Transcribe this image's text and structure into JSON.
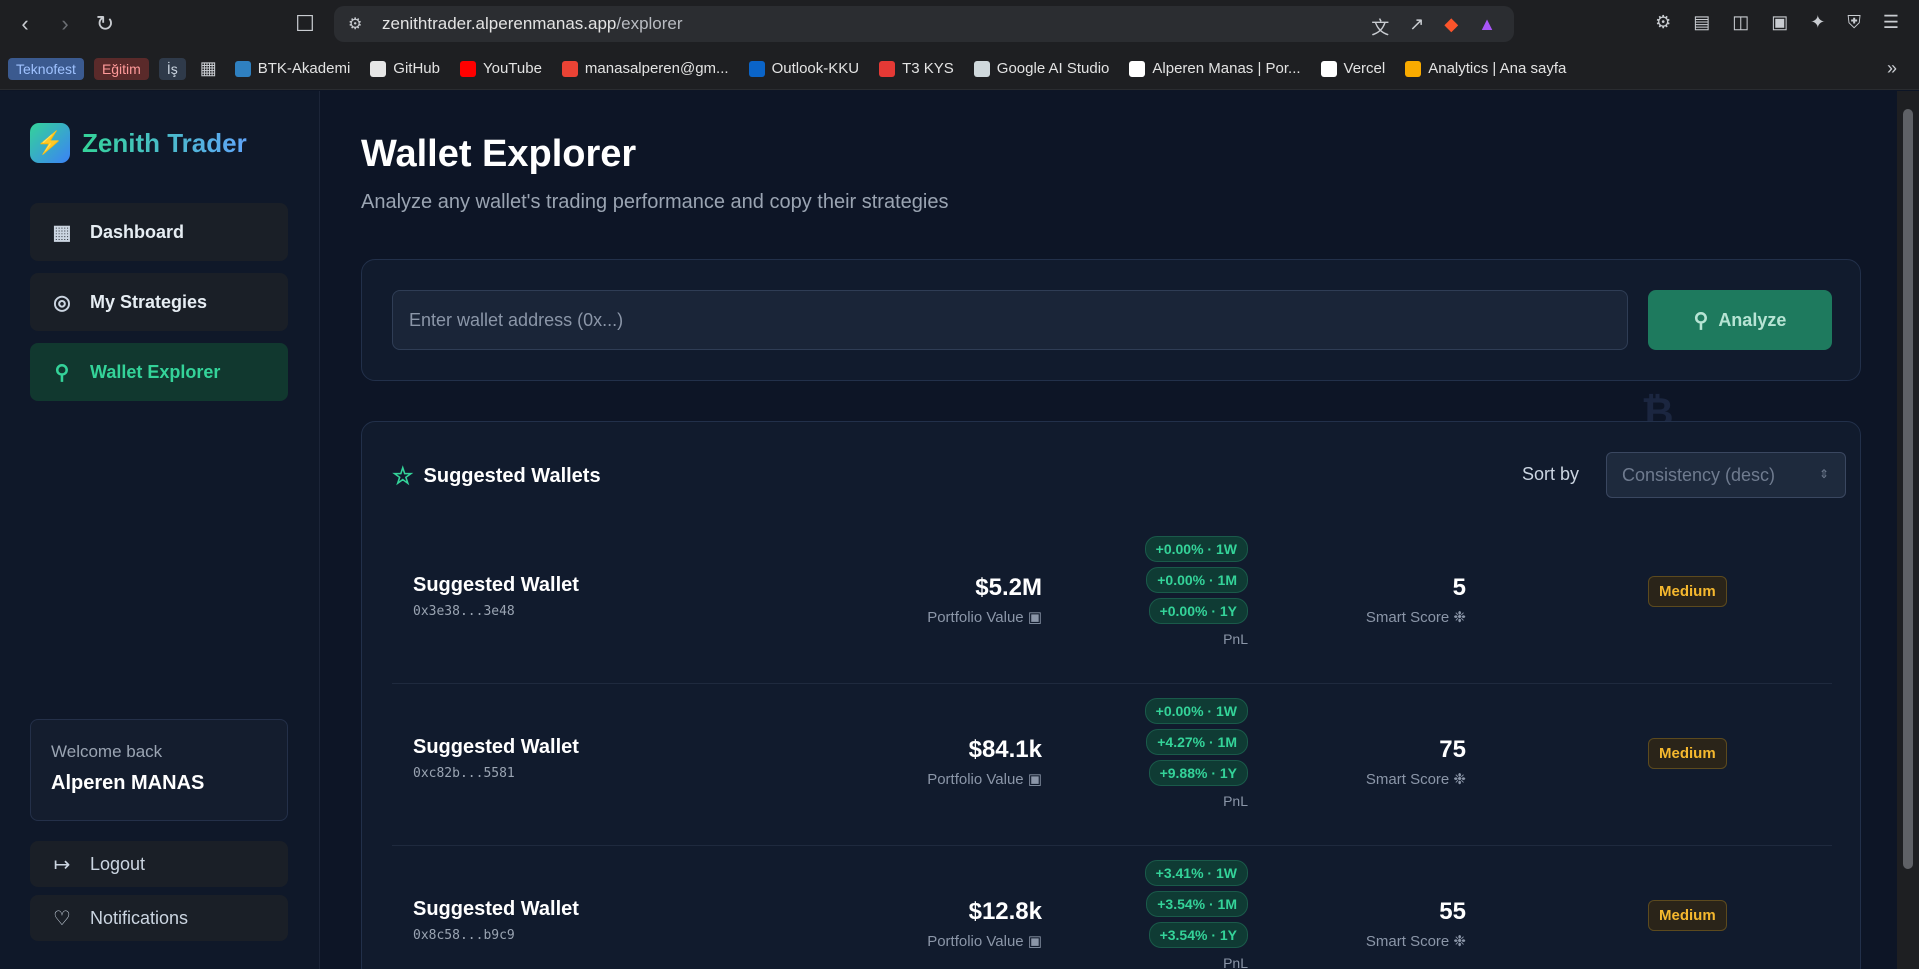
{
  "browser": {
    "url_host": "zenithtrader.alperenmanas.app",
    "url_path": "/explorer",
    "bookmarks_chips": [
      {
        "label": "Teknofest",
        "color": "#3b5a8f",
        "text_color": "#9fc2ff"
      },
      {
        "label": "Eğitim",
        "color": "#5a2a2a",
        "text_color": "#ff9a9a"
      },
      {
        "label": "İş",
        "color": "#2f3a4a",
        "text_color": "#cbd5e1"
      }
    ],
    "bookmarks": [
      {
        "label": "BTK-Akademi",
        "icon": "btk-icon",
        "color": "#2f80c0"
      },
      {
        "label": "GitHub",
        "icon": "github-icon",
        "color": "#e6e6e6"
      },
      {
        "label": "YouTube",
        "icon": "youtube-icon",
        "color": "#ff0000"
      },
      {
        "label": "manasalperen@gm...",
        "icon": "gmail-icon",
        "color": "#ea4335"
      },
      {
        "label": "Outlook-KKU",
        "icon": "outlook-icon",
        "color": "#0a64c8"
      },
      {
        "label": "T3 KYS",
        "icon": "t3-icon",
        "color": "#e53935"
      },
      {
        "label": "Google AI Studio",
        "icon": "ai-studio-icon",
        "color": "#cfd8dc"
      },
      {
        "label": "Alperen Manas | Por...",
        "icon": "triangle-icon",
        "color": "#ffffff"
      },
      {
        "label": "Vercel",
        "icon": "vercel-icon",
        "color": "#ffffff"
      },
      {
        "label": "Analytics | Ana sayfa",
        "icon": "analytics-icon",
        "color": "#f9ab00"
      }
    ]
  },
  "brand": {
    "name": "Zenith Trader"
  },
  "sidebar": {
    "items": [
      {
        "label": "Dashboard",
        "icon": "dashboard-icon"
      },
      {
        "label": "My Strategies",
        "icon": "target-icon"
      },
      {
        "label": "Wallet Explorer",
        "icon": "search-icon",
        "active": true
      }
    ],
    "welcome_label": "Welcome back",
    "user_name": "Alperen MANAS",
    "logout_label": "Logout",
    "notifications_label": "Notifications"
  },
  "page": {
    "title": "Wallet Explorer",
    "subtitle": "Analyze any wallet's trading performance and copy their strategies"
  },
  "search": {
    "placeholder": "Enter wallet address (0x...)",
    "button_label": "Analyze"
  },
  "suggested": {
    "title": "Suggested Wallets",
    "sort_label": "Sort by",
    "sort_value": "Consistency (desc)",
    "portfolio_label": "Portfolio Value",
    "pnl_label": "PnL",
    "score_label": "Smart Score",
    "wallets": [
      {
        "name": "Suggested Wallet",
        "address": "0x3e38...3e48",
        "portfolio": "$5.2M",
        "pnl": [
          "+0.00% · 1W",
          "+0.00% · 1M",
          "+0.00% · 1Y"
        ],
        "score": "5",
        "risk": "Medium"
      },
      {
        "name": "Suggested Wallet",
        "address": "0xc82b...5581",
        "portfolio": "$84.1k",
        "pnl": [
          "+0.00% · 1W",
          "+4.27% · 1M",
          "+9.88% · 1Y"
        ],
        "score": "75",
        "risk": "Medium"
      },
      {
        "name": "Suggested Wallet",
        "address": "0x8c58...b9c9",
        "portfolio": "$12.8k",
        "pnl": [
          "+3.41% · 1W",
          "+3.54% · 1M",
          "+3.54% · 1Y"
        ],
        "score": "55",
        "risk": "Medium"
      }
    ]
  },
  "colors": {
    "accent": "#34d399",
    "warning": "#f5b82e",
    "background": "#0d1526"
  }
}
